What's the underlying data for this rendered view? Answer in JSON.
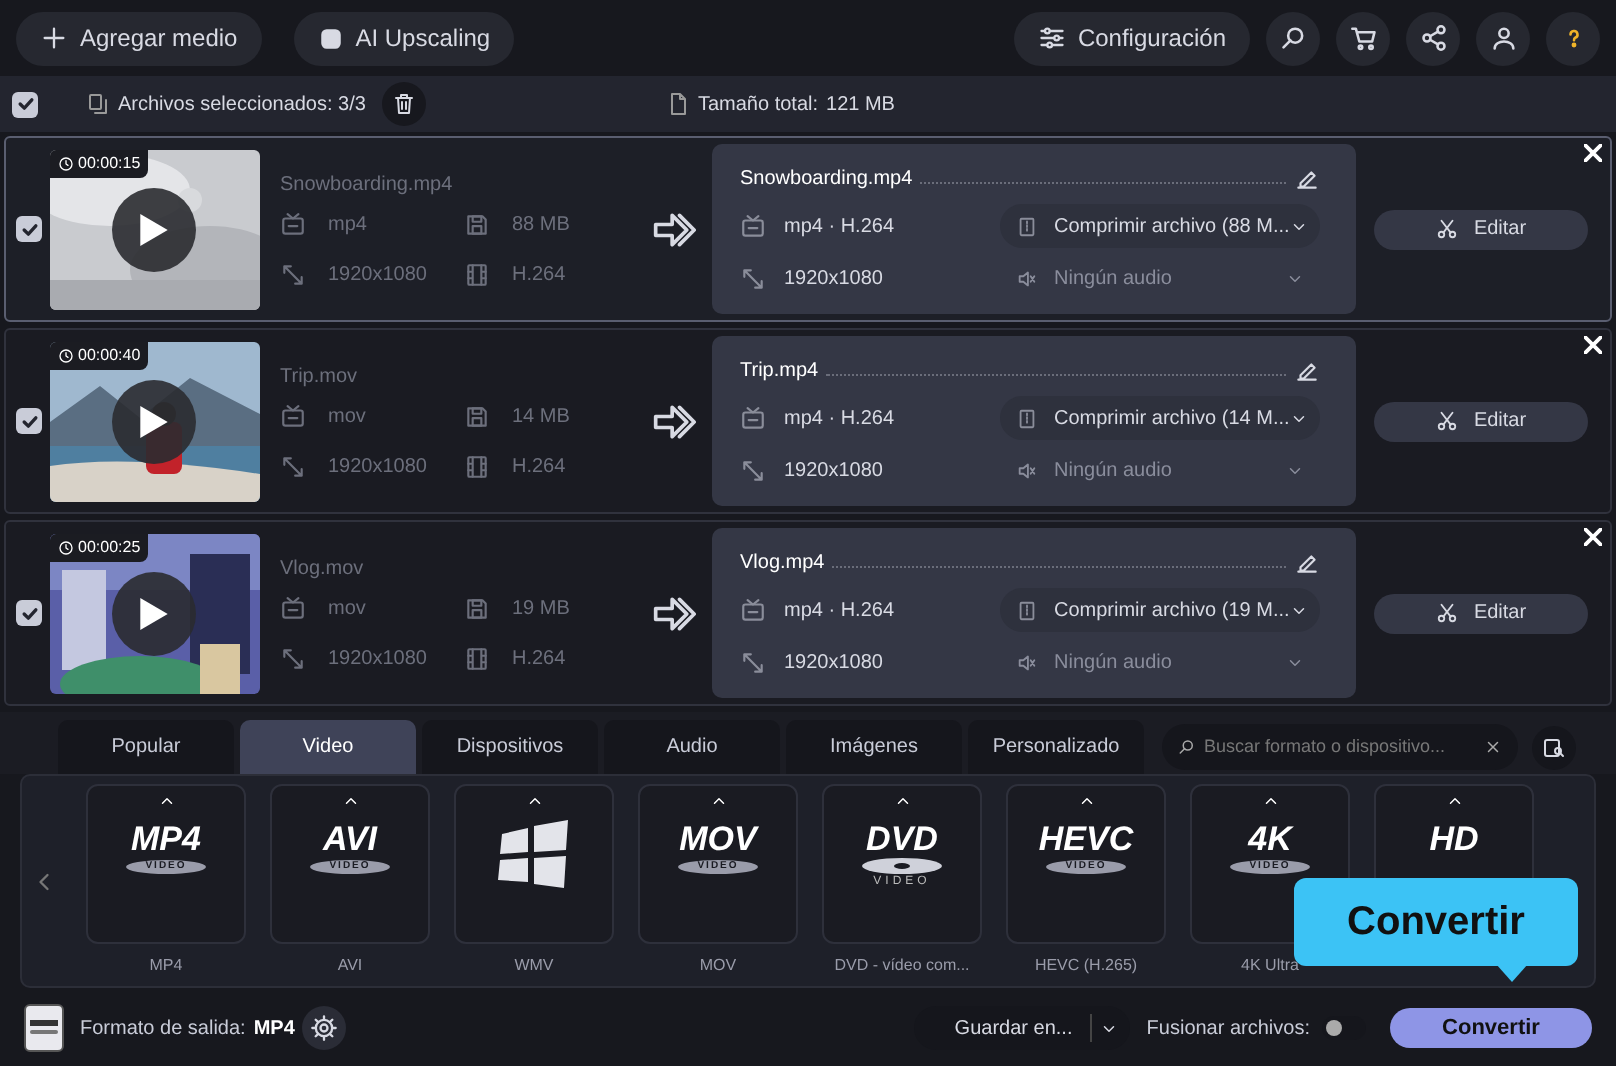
{
  "toolbar": {
    "add_media": "Agregar medio",
    "ai_upscaling": "AI Upscaling",
    "settings": "Configuración"
  },
  "selection_bar": {
    "checked": true,
    "selected_files": "Archivos seleccionados: 3/3",
    "total_size_label": "Tamaño total:",
    "total_size": "121 MB"
  },
  "files": [
    {
      "checked": true,
      "duration": "00:00:15",
      "name": "Snowboarding.mp4",
      "format": "mp4",
      "size": "88 MB",
      "resolution": "1920x1080",
      "codec": "H.264",
      "output_name": "Snowboarding.mp4",
      "output_format": "mp4 · H.264",
      "compression": "Comprimir archivo (88 M...",
      "output_resolution": "1920x1080",
      "audio": "Ningún audio",
      "audio_disabled": true,
      "edit": "Editar",
      "selected": true
    },
    {
      "checked": true,
      "duration": "00:00:40",
      "name": "Trip.mov",
      "format": "mov",
      "size": "14 MB",
      "resolution": "1920x1080",
      "codec": "H.264",
      "output_name": "Trip.mp4",
      "output_format": "mp4 · H.264",
      "compression": "Comprimir archivo (14 M...",
      "output_resolution": "1920x1080",
      "audio": "Ningún audio",
      "audio_disabled": true,
      "edit": "Editar",
      "selected": false
    },
    {
      "checked": true,
      "duration": "00:00:25",
      "name": "Vlog.mov",
      "format": "mov",
      "size": "19 MB",
      "resolution": "1920x1080",
      "codec": "H.264",
      "output_name": "Vlog.mp4",
      "output_format": "mp4 · H.264",
      "compression": "Comprimir archivo (19 M...",
      "output_resolution": "1920x1080",
      "audio": "Ningún audio",
      "audio_disabled": true,
      "edit": "Editar",
      "selected": false
    }
  ],
  "format_tabs": [
    {
      "label": "Popular",
      "selected": false
    },
    {
      "label": "Video",
      "selected": true
    },
    {
      "label": "Dispositivos",
      "selected": false
    },
    {
      "label": "Audio",
      "selected": false
    },
    {
      "label": "Imágenes",
      "selected": false
    },
    {
      "label": "Personalizado",
      "selected": false
    }
  ],
  "format_search": {
    "placeholder": "Buscar formato o dispositivo..."
  },
  "formats": [
    {
      "kind": "logo",
      "logo": "MP4",
      "sub": "VIDEO",
      "label": "MP4"
    },
    {
      "kind": "logo",
      "logo": "AVI",
      "sub": "VIDEO",
      "label": "AVI"
    },
    {
      "kind": "windows",
      "label": "WMV"
    },
    {
      "kind": "logo",
      "logo": "MOV",
      "sub": "VIDEO",
      "label": "MOV"
    },
    {
      "kind": "disc",
      "logo": "DVD",
      "sub": "VIDEO",
      "label": "DVD - vídeo com..."
    },
    {
      "kind": "logo",
      "logo": "HEVC",
      "sub": "VIDEO",
      "label": "HEVC (H.265)"
    },
    {
      "kind": "logo",
      "logo": "4K",
      "sub": "VIDEO",
      "label": "4K Ultra"
    },
    {
      "kind": "logo",
      "logo": "HD"
    }
  ],
  "footer": {
    "output_label": "Formato de salida:",
    "output_format": "MP4",
    "save_to": "Guardar en...",
    "merge_label": "Fusionar archivos:",
    "merge_on": false,
    "convert": "Convertir"
  },
  "tooltip": {
    "text": "Convertir"
  }
}
